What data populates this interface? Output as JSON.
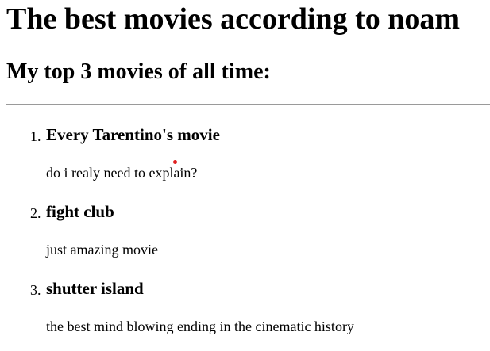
{
  "page": {
    "title": "The best movies according to noam",
    "subtitle": "My top 3 movies of all time:"
  },
  "movies": [
    {
      "number": "1.",
      "title": "Every Tarentino's movie",
      "description": "do i realy need to explain?"
    },
    {
      "number": "2.",
      "title": "fight club",
      "description": "just amazing movie"
    },
    {
      "number": "3.",
      "title": "shutter island",
      "description": "the best mind blowing ending in the cinematic history"
    }
  ],
  "colors": {
    "text": "#000000",
    "divider": "#9a9a9a",
    "cursor": "#e02020"
  }
}
